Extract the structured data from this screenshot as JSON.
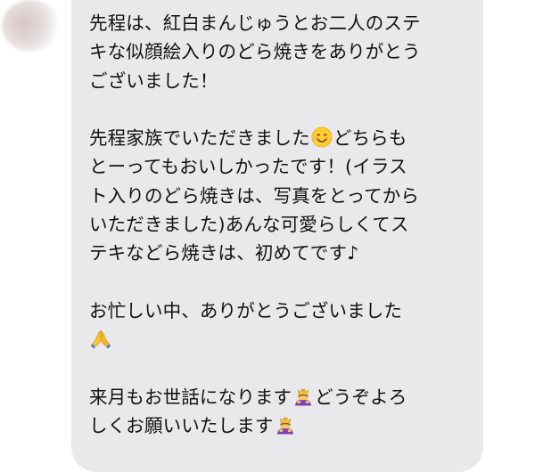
{
  "message": {
    "paragraphs": [
      {
        "lines": [
          {
            "text": "先程は、紅白まんじゅうとお二人のステ"
          },
          {
            "text": "キな似顔絵入りのどら焼きをありがとう"
          },
          {
            "text": "ございました！"
          }
        ]
      },
      {
        "lines": [
          {
            "text": "先程家族でいただきました",
            "emoji": "smiling-face-emoji",
            "after": "どちらも"
          },
          {
            "text": "とーってもおいしかったです！(イラス"
          },
          {
            "text": "ト入りのどら焼きは、写真をとってから"
          },
          {
            "text": "いただきました)あんな可愛らしくてス"
          },
          {
            "text": "テキなどら焼きは、初めてです♪"
          }
        ]
      },
      {
        "lines": [
          {
            "text": "お忙しい中、ありがとうございました"
          },
          {
            "text": "",
            "emoji": "folded-hands-emoji"
          }
        ]
      },
      {
        "lines": [
          {
            "text": "来月もお世話になります",
            "emoji": "bowing-person-emoji",
            "after": "どうぞよろ"
          },
          {
            "text": "しくお願いいたします",
            "emoji": "bowing-person-emoji"
          }
        ]
      }
    ]
  },
  "colors": {
    "bubble": "#e9e9eb",
    "text": "#111111",
    "background": "#ffffff"
  }
}
